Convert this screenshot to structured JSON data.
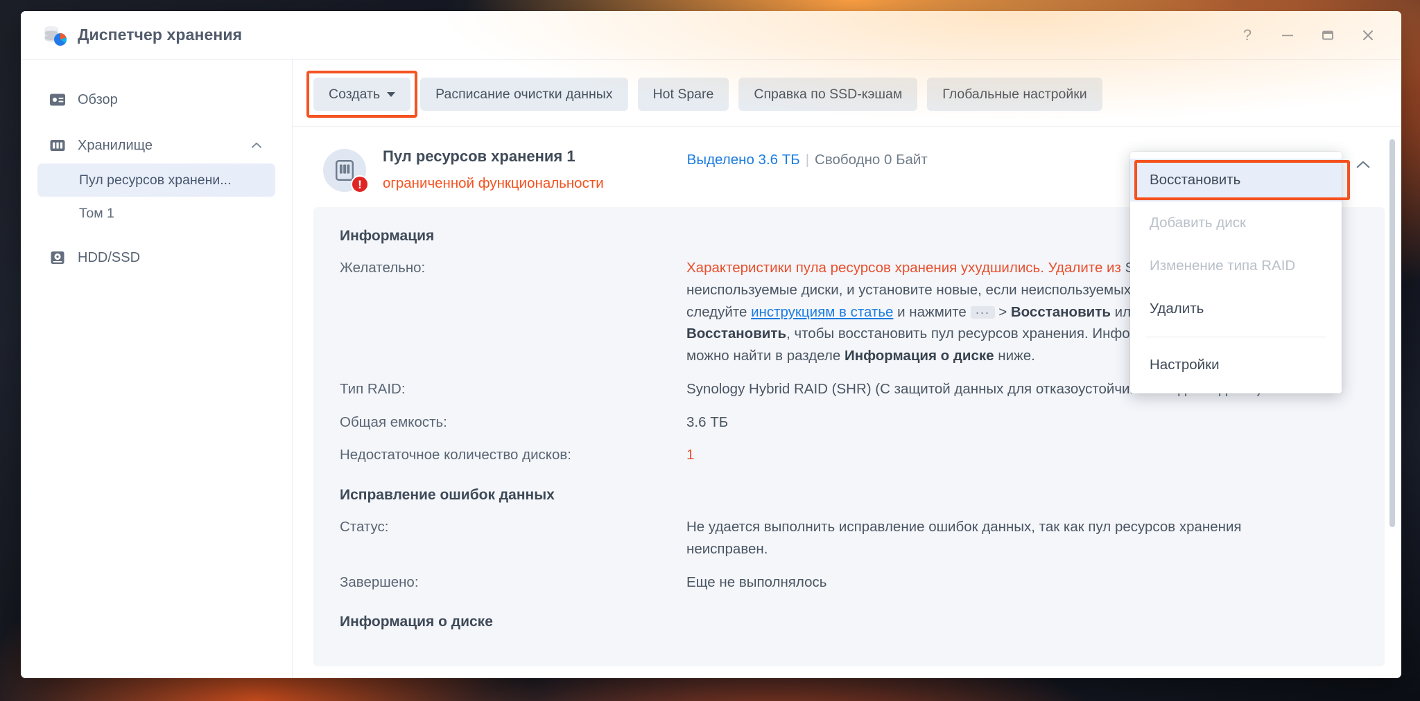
{
  "window": {
    "title": "Диспетчер хранения",
    "icon": "synology-storage-icon",
    "controls": {
      "help": "?",
      "minimize": "minimize-icon",
      "maximize": "maximize-icon",
      "close": "close-icon"
    }
  },
  "sidebar": {
    "items": [
      {
        "label": "Обзор",
        "icon": "overview-icon"
      },
      {
        "label": "Хранилище",
        "icon": "storage-icon",
        "expanded": true
      },
      {
        "label": "HDD/SSD",
        "icon": "disk-icon"
      }
    ],
    "sub_items": [
      {
        "label": "Пул ресурсов хранени...",
        "active": true
      },
      {
        "label": "Том 1",
        "active": false
      }
    ]
  },
  "toolbar": {
    "buttons": [
      {
        "label": "Создать",
        "has_caret": true,
        "highlighted": true
      },
      {
        "label": "Расписание очистки данных",
        "has_caret": false,
        "highlighted": false
      },
      {
        "label": "Hot Spare",
        "has_caret": false,
        "highlighted": false
      },
      {
        "label": "Справка по SSD-кэшам",
        "has_caret": false,
        "highlighted": false
      },
      {
        "label": "Глобальные настройки",
        "has_caret": false,
        "highlighted": false
      }
    ]
  },
  "pool": {
    "name": "Пул ресурсов хранения 1",
    "status": "ограниченной функциональности",
    "badge": "!",
    "allocated_label": "Выделено 3.6 ТБ",
    "separator": "|",
    "free_label": "Свободно 0 Байт",
    "more_icon": "⋯",
    "collapse_icon": "chevron-up-icon"
  },
  "menu": {
    "items": [
      {
        "label": "Восстановить",
        "state": "highlighted"
      },
      {
        "label": "Добавить диск",
        "state": "disabled"
      },
      {
        "label": "Изменение типа RAID",
        "state": "disabled"
      },
      {
        "label": "Удалить",
        "state": "normal"
      },
      {
        "label": "Настройки",
        "state": "normal",
        "after_separator": true
      }
    ]
  },
  "info": {
    "section_title": "Информация",
    "desirable_label": "Желательно:",
    "desirable_text_red": "Характеристики пула ресурсов хранения ухудшились. Удалите из",
    "desirable_text_rest_1": "Synology NAS неиспользуемые диски, и установите новые, если",
    "desirable_text_rest_2_a": "неиспользуемых дисков нет. После этого следуйте ",
    "desirable_text_rest_2_link": "инструкциям в статье",
    "desirable_text_rest_2_b": " и",
    "desirable_text_rest_3_a": "нажмите ",
    "desirable_text_rest_3_dots": "···",
    "desirable_text_rest_3_b": " > ",
    "desirable_text_rest_3_bold": "Восстановить",
    "desirable_text_rest_3_c": " или нажмите кнопку ",
    "desirable_text_rest_3_bold2": "Восстановить",
    "desirable_text_rest_3_d": ", чтобы",
    "desirable_text_rest_4": "восстановить пул ресурсов хранения. Информацию о состоянии диска можно",
    "desirable_text_rest_5_a": "найти в разделе ",
    "desirable_text_rest_5_bold": "Информация о диске",
    "desirable_text_rest_5_b": " ниже.",
    "raid_type_label": "Тип RAID:",
    "raid_type_value": "Synology Hybrid RAID (SHR) (С защитой данных для отказоустойчивости одного диска)",
    "total_capacity_label": "Общая емкость:",
    "total_capacity_value": "3.6 ТБ",
    "missing_disks_label": "Недостаточное количество дисков:",
    "missing_disks_value": "1"
  },
  "error_correction": {
    "section_title": "Исправление ошибок данных",
    "status_label": "Статус:",
    "status_value": "Не удается выполнить исправление ошибок данных, так как пул ресурсов хранения неисправен.",
    "completed_label": "Завершено:",
    "completed_value": "Еще не выполнялось"
  },
  "disk_info": {
    "section_title": "Информация о диске"
  },
  "colors": {
    "accent_orange": "#f4511e",
    "link_blue": "#1b7ce0",
    "danger_red": "#e8502e",
    "panel_bg": "#f4f6fa",
    "active_nav": "#e8eef9"
  }
}
